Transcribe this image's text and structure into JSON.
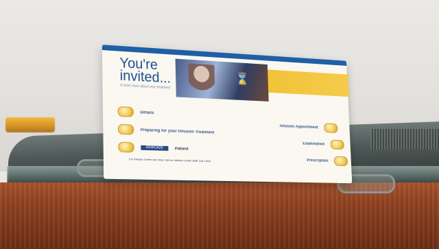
{
  "card": {
    "headline_line1": "You're",
    "headline_line2": "invited...",
    "subhead": "to learn more about your treatment",
    "left_menu": [
      {
        "label": "Details"
      },
      {
        "label": "Preparing for your Infusion Treatment"
      },
      {
        "label": "Patient"
      }
    ],
    "right_menu": [
      {
        "label": "Infusion Appointment"
      },
      {
        "label": "Examination"
      },
      {
        "label": "Prescription"
      }
    ],
    "logo_text": "REMICADE",
    "footer_note": "For Infusion Center Use Only. Call our Infusion Center Staff, Call 1-800-"
  },
  "colors": {
    "accent_blue": "#1f5fa6",
    "accent_yellow": "#f2c33a",
    "wood": "#8d3f1f"
  }
}
